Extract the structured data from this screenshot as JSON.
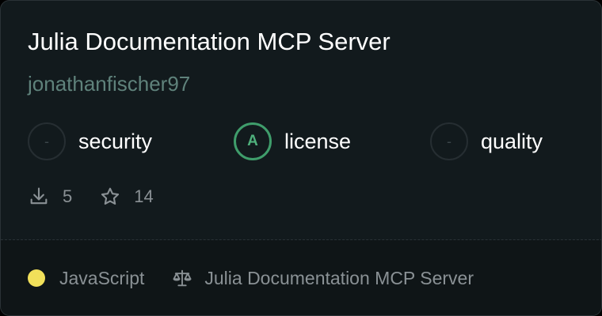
{
  "card": {
    "title": "Julia Documentation MCP Server",
    "author": "jonathanfischer97"
  },
  "scores": [
    {
      "label": "security",
      "grade": "-"
    },
    {
      "label": "license",
      "grade": "A"
    },
    {
      "label": "quality",
      "grade": "-"
    }
  ],
  "stats": {
    "downloads": "5",
    "stars": "14",
    "download_icon": "download-icon",
    "star_icon": "star-icon"
  },
  "footer": {
    "language": "JavaScript",
    "language_color": "#f1e05a",
    "license_icon": "scale-icon",
    "license": "Julia Documentation MCP Server"
  },
  "colors": {
    "background": "#121a1d",
    "footer_background": "#0f1517",
    "author": "#5f827b",
    "grade_a": "#3f9d6b",
    "muted_text": "#8a9195"
  }
}
